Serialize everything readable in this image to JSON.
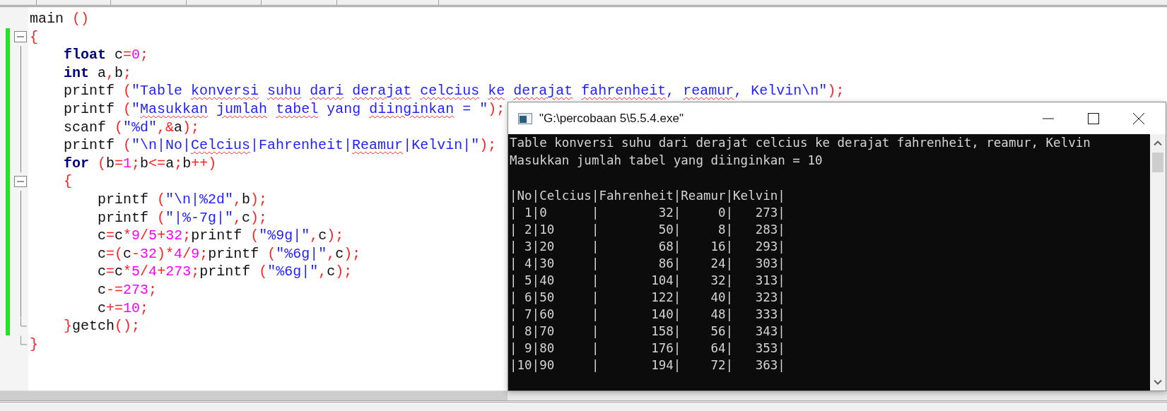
{
  "code": {
    "lines": [
      {
        "changed": false,
        "fold_start": false,
        "fold_end": false,
        "tokens": [
          {
            "text": "main",
            "kind": "id"
          },
          {
            "text": " ()",
            "kind": "sym"
          }
        ]
      },
      {
        "changed": true,
        "fold_start": true,
        "fold_end": false,
        "tokens": [
          {
            "text": "{",
            "kind": "sym"
          }
        ]
      },
      {
        "changed": true,
        "fold_start": false,
        "fold_end": false,
        "tokens": [
          {
            "text": "    float",
            "kind": "kw"
          },
          {
            "text": " c",
            "kind": "id"
          },
          {
            "text": "=",
            "kind": "sym"
          },
          {
            "text": "0",
            "kind": "num"
          },
          {
            "text": ";",
            "kind": "sym"
          }
        ]
      },
      {
        "changed": true,
        "fold_start": false,
        "fold_end": false,
        "tokens": [
          {
            "text": "    int",
            "kind": "kw"
          },
          {
            "text": " a",
            "kind": "id"
          },
          {
            "text": ",",
            "kind": "sym"
          },
          {
            "text": "b",
            "kind": "id"
          },
          {
            "text": ";",
            "kind": "sym"
          }
        ]
      },
      {
        "changed": true,
        "fold_start": false,
        "fold_end": false,
        "tokens": [
          {
            "text": "    printf",
            "kind": "id"
          },
          {
            "text": " (",
            "kind": "sym"
          },
          {
            "text": "\"Table ",
            "kind": "str"
          },
          {
            "text": "konversi ",
            "kind": "typo"
          },
          {
            "text": "suhu ",
            "kind": "typo"
          },
          {
            "text": "dari ",
            "kind": "typo"
          },
          {
            "text": "derajat ",
            "kind": "typo"
          },
          {
            "text": "celcius ",
            "kind": "typo"
          },
          {
            "text": "ke ",
            "kind": "typo"
          },
          {
            "text": "derajat ",
            "kind": "typo"
          },
          {
            "text": "fahrenheit",
            "kind": "typo"
          },
          {
            "text": ", ",
            "kind": "str"
          },
          {
            "text": "reamur",
            "kind": "typo"
          },
          {
            "text": ", Kelvin\\n\"",
            "kind": "str"
          },
          {
            "text": ");",
            "kind": "sym"
          }
        ]
      },
      {
        "changed": true,
        "fold_start": false,
        "fold_end": false,
        "tokens": [
          {
            "text": "    printf",
            "kind": "id"
          },
          {
            "text": " (",
            "kind": "sym"
          },
          {
            "text": "\"",
            "kind": "str"
          },
          {
            "text": "Masukkan ",
            "kind": "typo"
          },
          {
            "text": "jumlah ",
            "kind": "typo"
          },
          {
            "text": "tabel",
            "kind": "typo"
          },
          {
            "text": " yang ",
            "kind": "str"
          },
          {
            "text": "diinginkan",
            "kind": "typo"
          },
          {
            "text": " = \"",
            "kind": "str"
          },
          {
            "text": ");",
            "kind": "sym"
          }
        ]
      },
      {
        "changed": true,
        "fold_start": false,
        "fold_end": false,
        "tokens": [
          {
            "text": "    scanf",
            "kind": "id"
          },
          {
            "text": " (",
            "kind": "sym"
          },
          {
            "text": "\"%d\"",
            "kind": "str"
          },
          {
            "text": ",&",
            "kind": "sym"
          },
          {
            "text": "a",
            "kind": "id"
          },
          {
            "text": ");",
            "kind": "sym"
          }
        ]
      },
      {
        "changed": true,
        "fold_start": false,
        "fold_end": false,
        "tokens": [
          {
            "text": "    printf",
            "kind": "id"
          },
          {
            "text": " (",
            "kind": "sym"
          },
          {
            "text": "\"\\n|No|",
            "kind": "str"
          },
          {
            "text": "Celcius",
            "kind": "typo"
          },
          {
            "text": "|Fahrenheit|",
            "kind": "str"
          },
          {
            "text": "Reamur",
            "kind": "typo"
          },
          {
            "text": "|Kelvin|\"",
            "kind": "str"
          },
          {
            "text": ");",
            "kind": "sym"
          }
        ]
      },
      {
        "changed": true,
        "fold_start": false,
        "fold_end": false,
        "tokens": [
          {
            "text": "    for",
            "kind": "kw"
          },
          {
            "text": " (",
            "kind": "sym"
          },
          {
            "text": "b",
            "kind": "id"
          },
          {
            "text": "=",
            "kind": "sym"
          },
          {
            "text": "1",
            "kind": "num"
          },
          {
            "text": ";",
            "kind": "sym"
          },
          {
            "text": "b",
            "kind": "id"
          },
          {
            "text": "<=",
            "kind": "sym"
          },
          {
            "text": "a",
            "kind": "id"
          },
          {
            "text": ";",
            "kind": "sym"
          },
          {
            "text": "b",
            "kind": "id"
          },
          {
            "text": "++)",
            "kind": "sym"
          }
        ]
      },
      {
        "changed": true,
        "fold_start": true,
        "fold_end": false,
        "tokens": [
          {
            "text": "    {",
            "kind": "sym"
          }
        ]
      },
      {
        "changed": true,
        "fold_start": false,
        "fold_end": false,
        "tokens": [
          {
            "text": "        printf",
            "kind": "id"
          },
          {
            "text": " (",
            "kind": "sym"
          },
          {
            "text": "\"\\n|%2d\"",
            "kind": "str"
          },
          {
            "text": ",",
            "kind": "sym"
          },
          {
            "text": "b",
            "kind": "id"
          },
          {
            "text": ");",
            "kind": "sym"
          }
        ]
      },
      {
        "changed": true,
        "fold_start": false,
        "fold_end": false,
        "tokens": [
          {
            "text": "        printf",
            "kind": "id"
          },
          {
            "text": " (",
            "kind": "sym"
          },
          {
            "text": "\"|%-7g|\"",
            "kind": "str"
          },
          {
            "text": ",",
            "kind": "sym"
          },
          {
            "text": "c",
            "kind": "id"
          },
          {
            "text": ");",
            "kind": "sym"
          }
        ]
      },
      {
        "changed": true,
        "fold_start": false,
        "fold_end": false,
        "tokens": [
          {
            "text": "        c",
            "kind": "id"
          },
          {
            "text": "=",
            "kind": "sym"
          },
          {
            "text": "c",
            "kind": "id"
          },
          {
            "text": "*",
            "kind": "sym"
          },
          {
            "text": "9",
            "kind": "num"
          },
          {
            "text": "/",
            "kind": "sym"
          },
          {
            "text": "5",
            "kind": "num"
          },
          {
            "text": "+",
            "kind": "sym"
          },
          {
            "text": "32",
            "kind": "num"
          },
          {
            "text": ";",
            "kind": "sym"
          },
          {
            "text": "printf",
            "kind": "id"
          },
          {
            "text": " (",
            "kind": "sym"
          },
          {
            "text": "\"%9g|\"",
            "kind": "str"
          },
          {
            "text": ",",
            "kind": "sym"
          },
          {
            "text": "c",
            "kind": "id"
          },
          {
            "text": ");",
            "kind": "sym"
          }
        ]
      },
      {
        "changed": true,
        "fold_start": false,
        "fold_end": false,
        "tokens": [
          {
            "text": "        c",
            "kind": "id"
          },
          {
            "text": "=(",
            "kind": "sym"
          },
          {
            "text": "c",
            "kind": "id"
          },
          {
            "text": "-",
            "kind": "sym"
          },
          {
            "text": "32",
            "kind": "num"
          },
          {
            "text": ")*",
            "kind": "sym"
          },
          {
            "text": "4",
            "kind": "num"
          },
          {
            "text": "/",
            "kind": "sym"
          },
          {
            "text": "9",
            "kind": "num"
          },
          {
            "text": ";",
            "kind": "sym"
          },
          {
            "text": "printf",
            "kind": "id"
          },
          {
            "text": " (",
            "kind": "sym"
          },
          {
            "text": "\"%6g|\"",
            "kind": "str"
          },
          {
            "text": ",",
            "kind": "sym"
          },
          {
            "text": "c",
            "kind": "id"
          },
          {
            "text": ");",
            "kind": "sym"
          }
        ]
      },
      {
        "changed": true,
        "fold_start": false,
        "fold_end": false,
        "tokens": [
          {
            "text": "        c",
            "kind": "id"
          },
          {
            "text": "=",
            "kind": "sym"
          },
          {
            "text": "c",
            "kind": "id"
          },
          {
            "text": "*",
            "kind": "sym"
          },
          {
            "text": "5",
            "kind": "num"
          },
          {
            "text": "/",
            "kind": "sym"
          },
          {
            "text": "4",
            "kind": "num"
          },
          {
            "text": "+",
            "kind": "sym"
          },
          {
            "text": "273",
            "kind": "num"
          },
          {
            "text": ";",
            "kind": "sym"
          },
          {
            "text": "printf",
            "kind": "id"
          },
          {
            "text": " (",
            "kind": "sym"
          },
          {
            "text": "\"%6g|\"",
            "kind": "str"
          },
          {
            "text": ",",
            "kind": "sym"
          },
          {
            "text": "c",
            "kind": "id"
          },
          {
            "text": ");",
            "kind": "sym"
          }
        ]
      },
      {
        "changed": true,
        "fold_start": false,
        "fold_end": false,
        "tokens": [
          {
            "text": "        c",
            "kind": "id"
          },
          {
            "text": "-=",
            "kind": "sym"
          },
          {
            "text": "273",
            "kind": "num"
          },
          {
            "text": ";",
            "kind": "sym"
          }
        ]
      },
      {
        "changed": true,
        "fold_start": false,
        "fold_end": false,
        "tokens": [
          {
            "text": "        c",
            "kind": "id"
          },
          {
            "text": "+=",
            "kind": "sym"
          },
          {
            "text": "10",
            "kind": "num"
          },
          {
            "text": ";",
            "kind": "sym"
          }
        ]
      },
      {
        "changed": true,
        "fold_start": false,
        "fold_end": true,
        "tokens": [
          {
            "text": "    }",
            "kind": "sym"
          },
          {
            "text": "getch",
            "kind": "id"
          },
          {
            "text": "()",
            "kind": "sym"
          },
          {
            "text": ";",
            "kind": "sym"
          }
        ]
      },
      {
        "changed": false,
        "fold_start": false,
        "fold_end": true,
        "tokens": [
          {
            "text": "}",
            "kind": "sym"
          }
        ]
      }
    ]
  },
  "console": {
    "title": "\"G:\\percobaan 5\\5.5.4.exe\"",
    "lines": [
      "Table konversi suhu dari derajat celcius ke derajat fahrenheit, reamur, Kelvin",
      "Masukkan jumlah tabel yang diinginkan = 10"
    ],
    "table_lines": [
      "|No|Celcius|Fahrenheit|Reamur|Kelvin|",
      "| 1|0      |        32|     0|   273|",
      "| 2|10     |        50|     8|   283|",
      "| 3|20     |        68|    16|   293|",
      "| 4|30     |        86|    24|   303|",
      "| 5|40     |       104|    32|   313|",
      "| 6|50     |       122|    40|   323|",
      "| 7|60     |       140|    48|   333|",
      "| 8|70     |       158|    56|   343|",
      "| 9|80     |       176|    64|   353|",
      "|10|90     |       194|    72|   363|"
    ]
  }
}
